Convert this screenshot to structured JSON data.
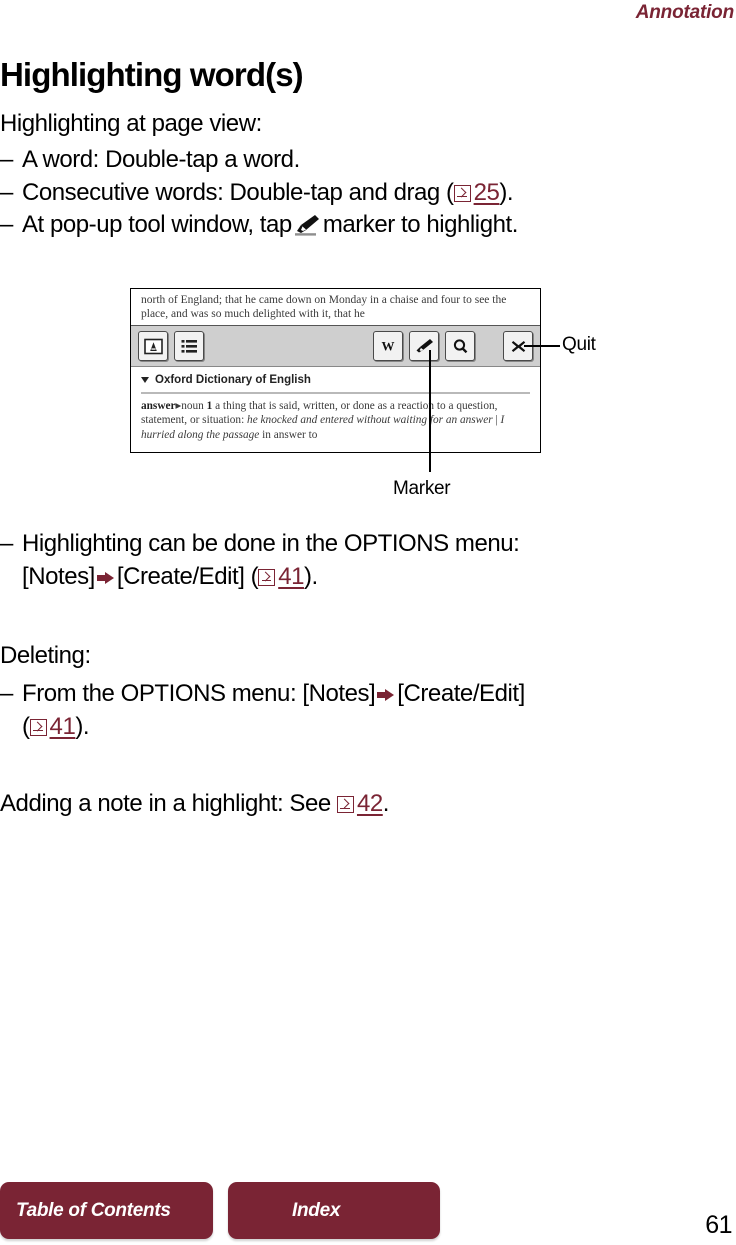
{
  "running_head": "Annotation",
  "page_title": "Highlighting word(s)",
  "intro": "Highlighting at page view:",
  "bullets_top": [
    {
      "dash": "–",
      "text_before": "A word: Double-tap a word.",
      "text_after": "",
      "ref": null
    },
    {
      "dash": "–",
      "text_before": "Consecutive words: Double-tap and drag (",
      "text_after": ").",
      "ref": "25"
    },
    {
      "dash": "–",
      "text_before": "At pop-up tool window, tap",
      "text_after": "marker to highlight.",
      "ref": null
    }
  ],
  "bullet_options": {
    "dash": "–",
    "line1": "Highlighting can be done in the OPTIONS menu:",
    "line2_a": "[Notes]",
    "line2_b": "[Create/Edit] (",
    "line2_c": ").",
    "ref": "41"
  },
  "deleting": {
    "label": "Deleting:",
    "dash": "–",
    "line1_a": "From the OPTIONS menu: [Notes]",
    "line1_b": "[Create/Edit]",
    "line2_a": "(",
    "line2_b": ").",
    "ref": "41"
  },
  "note_line": {
    "text_before": "Adding a note in a highlight: See",
    "text_after": ".",
    "ref": "42"
  },
  "figure": {
    "book_text": "north of England; that he came down on Monday in a chaise and four to see the place, and was so much delighted with it, that he",
    "toolbar": {
      "left_buttons": [
        {
          "name": "dictionary-icon",
          "glyph": "A"
        },
        {
          "name": "list-icon",
          "glyph": "list"
        }
      ],
      "right_buttons": [
        {
          "name": "wikipedia-icon",
          "glyph": "W"
        },
        {
          "name": "marker-icon",
          "glyph": "marker"
        },
        {
          "name": "search-icon",
          "glyph": "magnifier"
        },
        {
          "name": "close-icon",
          "glyph": "x"
        }
      ]
    },
    "dictionary": {
      "title": "Oxford Dictionary of English",
      "headword": "answer",
      "pos": "noun",
      "sense_num": "1",
      "definition_1": " a thing that is said, written, or done as a reaction to a question, statement, or situation: ",
      "example_1": "he knocked and entered without waiting for an answer",
      "separator": " | ",
      "example_2": "I hurried along the passage",
      "definition_2": " in answer to"
    }
  },
  "callouts": {
    "quit": "Quit",
    "marker": "Marker"
  },
  "footer": {
    "table_of_contents": "Table of Contents",
    "index": "Index",
    "page_number": "61"
  },
  "colors": {
    "accent": "#7a2434",
    "text": "#000000",
    "toolbar_bg": "#cfcfcf"
  }
}
